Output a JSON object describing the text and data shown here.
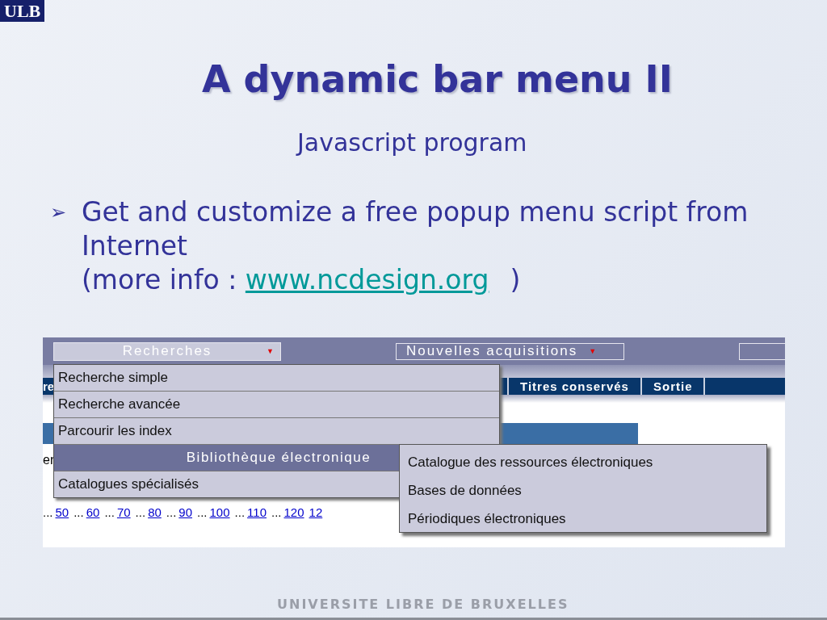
{
  "logo": "ULB",
  "title": "A dynamic bar menu II",
  "subtitle": "Javascript program",
  "bullet": {
    "marker": "➢",
    "text": "Get and customize a free popup menu script from Internet",
    "note_prefix": "(more info : ",
    "link": "www.ncdesign.org",
    "note_suffix": ")"
  },
  "screenshot": {
    "dropdowns": [
      {
        "label": "Recherches",
        "open": true,
        "caret": "▼"
      },
      {
        "label": "Nouvelles acquisitions",
        "open": false,
        "caret": "▼"
      },
      {
        "open": false
      }
    ],
    "nav_fragment": "re",
    "nav_tabs": [
      "Titres conservés",
      "Sortie"
    ],
    "text_fragment": "er",
    "page_links": [
      {
        "prefix": "...",
        "label": "50"
      },
      {
        "prefix": "...",
        "label": "60"
      },
      {
        "prefix": "...",
        "label": "70"
      },
      {
        "prefix": "...",
        "label": "80"
      },
      {
        "prefix": "...",
        "label": "90"
      },
      {
        "prefix": "...",
        "label": "100"
      },
      {
        "prefix": "...",
        "label": "110"
      },
      {
        "prefix": "...",
        "label": "120"
      },
      {
        "label": "12"
      }
    ],
    "menu": [
      {
        "label": "Recherche simple",
        "selected": false
      },
      {
        "label": "Recherche avancée",
        "selected": false
      },
      {
        "label": "Parcourir les index",
        "selected": false
      },
      {
        "label": "Bibliothèque électronique",
        "selected": true
      },
      {
        "label": "Catalogues spécialisés",
        "selected": false
      }
    ],
    "submenu": [
      "Catalogue des ressources électroniques",
      "Bases de données",
      "Périodiques électroniques"
    ]
  },
  "footer": "UNIVERSITE LIBRE DE BRUXELLES"
}
